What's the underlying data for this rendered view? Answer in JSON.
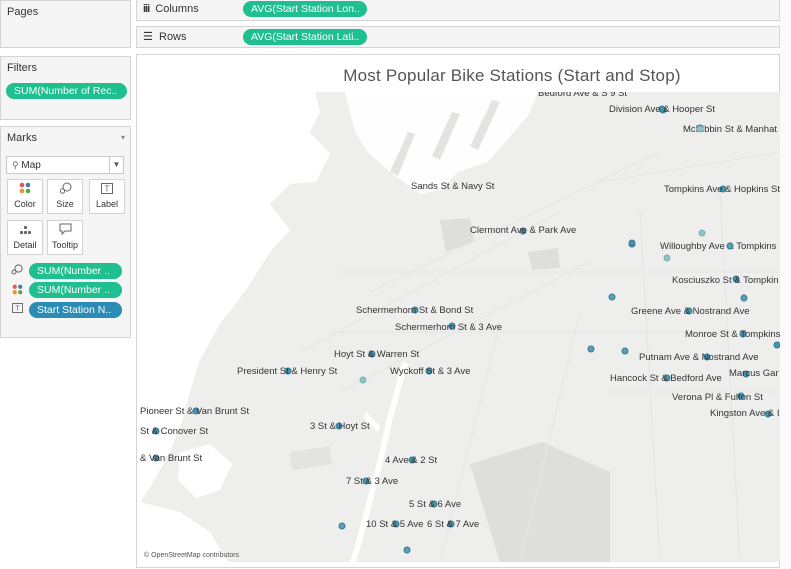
{
  "pages": {
    "title": "Pages"
  },
  "filters": {
    "title": "Filters",
    "pill": "SUM(Number of Rec.."
  },
  "marks": {
    "title": "Marks",
    "type": "Map",
    "buttons": {
      "color": "Color",
      "size": "Size",
      "label": "Label",
      "detail": "Detail",
      "tooltip": "Tooltip"
    },
    "encodings": [
      {
        "label": "SUM(Number ..",
        "color": "#1fbf8f",
        "icon": "size-icon"
      },
      {
        "label": "SUM(Number ..",
        "color": "#1fbf8f",
        "icon": "color-icon"
      },
      {
        "label": "Start Station N..",
        "color": "#2b8cb6",
        "icon": "label-icon"
      }
    ]
  },
  "shelves": {
    "columns": {
      "label": "Columns",
      "pill": "AVG(Start Station Lon.."
    },
    "rows": {
      "label": "Rows",
      "pill": "AVG(Start Station Lati.."
    }
  },
  "view": {
    "title": "Most Popular Bike Stations (Start and Stop)",
    "attribution": "© OpenStreetMap contributors"
  },
  "stations": [
    {
      "name": "Bedford Ave & S 9 St"
    },
    {
      "name": "Division Ave & Hooper St"
    },
    {
      "name": "McKibbin St & Manhat"
    },
    {
      "name": "Sands St & Navy St"
    },
    {
      "name": "Tompkins Ave & Hopkins St"
    },
    {
      "name": "Clermont Ave & Park Ave"
    },
    {
      "name": "Willoughby Ave & Tompkins"
    },
    {
      "name": "Kosciuszko St & Tompkin"
    },
    {
      "name": "Schermerhorn St & Bond St"
    },
    {
      "name": "Greene Ave & Nostrand Ave"
    },
    {
      "name": "Schermerhorn St & 3 Ave"
    },
    {
      "name": "Monroe St & Tompkins"
    },
    {
      "name": "Hoyt St & Warren St"
    },
    {
      "name": "Putnam Ave & Nostrand Ave"
    },
    {
      "name": "President St & Henry St"
    },
    {
      "name": "Wyckoff St & 3 Ave"
    },
    {
      "name": "Hancock St & Bedford Ave"
    },
    {
      "name": "Marcus Gar"
    },
    {
      "name": "Verona Pl & Fulton St"
    },
    {
      "name": "Pioneer St & Van Brunt St"
    },
    {
      "name": "Kingston Ave & I"
    },
    {
      "name": "3 St & Hoyt St"
    },
    {
      "name": "St & Conover St"
    },
    {
      "name": "& Van Brunt St"
    },
    {
      "name": "4 Ave & 2 St"
    },
    {
      "name": "7 St & 3 Ave"
    },
    {
      "name": "5 St & 6 Ave"
    },
    {
      "name": "10 St & 5 Ave"
    },
    {
      "name": "6 St & 7 Ave"
    }
  ]
}
